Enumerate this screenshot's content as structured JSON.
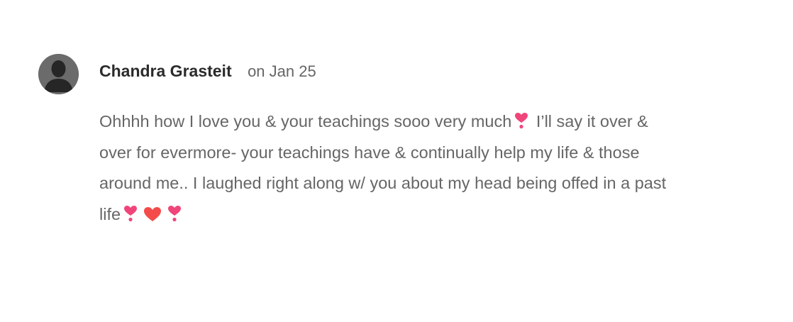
{
  "comment": {
    "author": "Chandra Grasteit",
    "date": "on Jan 25",
    "text_parts": [
      "Ohhhh how I love you & your teachings sooo very much",
      "I’ll say it over &",
      "over for evermore- your teachings have & continually help my life & those",
      "around me.. I laughed right along w/ you about my head being offed in a past",
      "life"
    ],
    "emojis": [
      "heart-exclamation-icon",
      "red-heart-icon"
    ]
  },
  "colors": {
    "author": "#2b2b2b",
    "text": "#666666",
    "avatar_bg": "#6e6e6e",
    "heart_pink": "#f0457a",
    "heart_red": "#f44a4a"
  }
}
